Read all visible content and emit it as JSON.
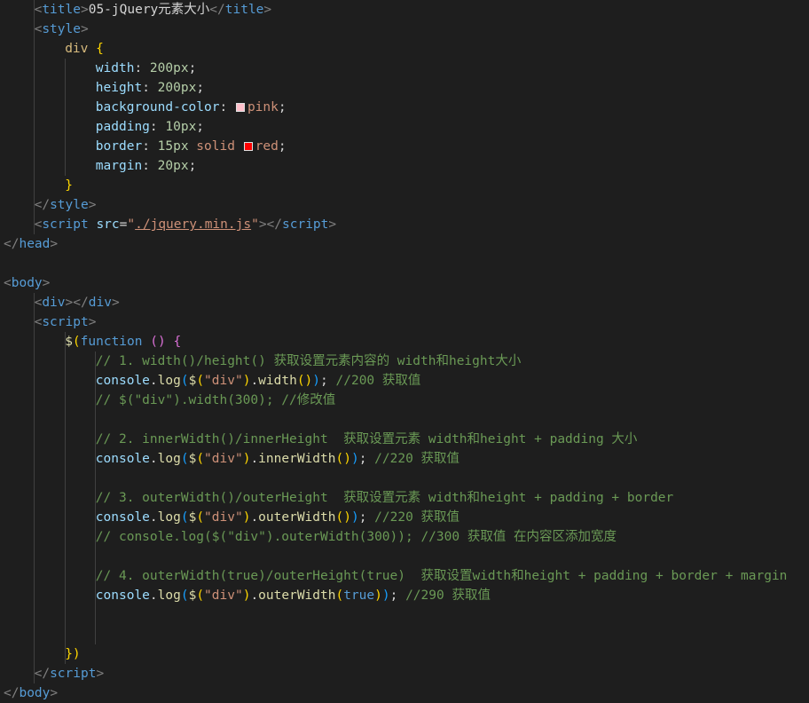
{
  "editor": {
    "lines": [
      [
        {
          "t": "<",
          "c": "punct"
        },
        {
          "t": "title",
          "c": "tag"
        },
        {
          "t": ">",
          "c": "punct"
        },
        {
          "t": "05-jQuery元素大小",
          "c": "text"
        },
        {
          "t": "</",
          "c": "punct"
        },
        {
          "t": "title",
          "c": "tag"
        },
        {
          "t": ">",
          "c": "punct"
        }
      ],
      [
        {
          "t": "<",
          "c": "punct"
        },
        {
          "t": "style",
          "c": "tag"
        },
        {
          "t": ">",
          "c": "punct"
        }
      ],
      [
        {
          "t": "div",
          "c": "sel"
        },
        {
          "t": " ",
          "c": "text"
        },
        {
          "t": "{",
          "c": "brace"
        }
      ],
      [
        {
          "t": "width",
          "c": "prop"
        },
        {
          "t": ": ",
          "c": "text"
        },
        {
          "t": "200px",
          "c": "num"
        },
        {
          "t": ";",
          "c": "text"
        }
      ],
      [
        {
          "t": "height",
          "c": "prop"
        },
        {
          "t": ": ",
          "c": "text"
        },
        {
          "t": "200px",
          "c": "num"
        },
        {
          "t": ";",
          "c": "text"
        }
      ],
      [
        {
          "t": "background-color",
          "c": "prop"
        },
        {
          "t": ": ",
          "c": "text"
        },
        {
          "swatch": "#ffc0cb"
        },
        {
          "t": "pink",
          "c": "val"
        },
        {
          "t": ";",
          "c": "text"
        }
      ],
      [
        {
          "t": "padding",
          "c": "prop"
        },
        {
          "t": ": ",
          "c": "text"
        },
        {
          "t": "10px",
          "c": "num"
        },
        {
          "t": ";",
          "c": "text"
        }
      ],
      [
        {
          "t": "border",
          "c": "prop"
        },
        {
          "t": ": ",
          "c": "text"
        },
        {
          "t": "15px",
          "c": "num"
        },
        {
          "t": " solid ",
          "c": "val"
        },
        {
          "swatch": "#ff0000"
        },
        {
          "t": "red",
          "c": "val"
        },
        {
          "t": ";",
          "c": "text"
        }
      ],
      [
        {
          "t": "margin",
          "c": "prop"
        },
        {
          "t": ": ",
          "c": "text"
        },
        {
          "t": "20px",
          "c": "num"
        },
        {
          "t": ";",
          "c": "text"
        }
      ],
      [
        {
          "t": "}",
          "c": "brace"
        }
      ],
      [
        {
          "t": "</",
          "c": "punct"
        },
        {
          "t": "style",
          "c": "tag"
        },
        {
          "t": ">",
          "c": "punct"
        }
      ],
      [
        {
          "t": "<",
          "c": "punct"
        },
        {
          "t": "script",
          "c": "tag"
        },
        {
          "t": " ",
          "c": "text"
        },
        {
          "t": "src",
          "c": "attr"
        },
        {
          "t": "=",
          "c": "text"
        },
        {
          "t": "\"",
          "c": "str"
        },
        {
          "t": "./jquery.min.js",
          "c": "link"
        },
        {
          "t": "\"",
          "c": "str"
        },
        {
          "t": "></",
          "c": "punct"
        },
        {
          "t": "script",
          "c": "tag"
        },
        {
          "t": ">",
          "c": "punct"
        }
      ],
      [
        {
          "t": "</",
          "c": "punct"
        },
        {
          "t": "head",
          "c": "tag"
        },
        {
          "t": ">",
          "c": "punct"
        }
      ],
      [],
      [
        {
          "t": "<",
          "c": "punct"
        },
        {
          "t": "body",
          "c": "tag"
        },
        {
          "t": ">",
          "c": "punct"
        }
      ],
      [
        {
          "t": "<",
          "c": "punct"
        },
        {
          "t": "div",
          "c": "tag"
        },
        {
          "t": "></",
          "c": "punct"
        },
        {
          "t": "div",
          "c": "tag"
        },
        {
          "t": ">",
          "c": "punct"
        }
      ],
      [
        {
          "t": "<",
          "c": "punct"
        },
        {
          "t": "script",
          "c": "tag"
        },
        {
          "t": ">",
          "c": "punct"
        }
      ],
      [
        {
          "t": "$",
          "c": "func"
        },
        {
          "t": "(",
          "c": "br1"
        },
        {
          "t": "function",
          "c": "kw"
        },
        {
          "t": " ",
          "c": "text"
        },
        {
          "t": "()",
          "c": "br2"
        },
        {
          "t": " ",
          "c": "text"
        },
        {
          "t": "{",
          "c": "br2"
        }
      ],
      [
        {
          "t": "// 1. width()/height() 获取设置元素内容的 width和height大小",
          "c": "comment"
        }
      ],
      [
        {
          "t": "console",
          "c": "var"
        },
        {
          "t": ".",
          "c": "text"
        },
        {
          "t": "log",
          "c": "func"
        },
        {
          "t": "(",
          "c": "br3"
        },
        {
          "t": "$",
          "c": "func"
        },
        {
          "t": "(",
          "c": "br1"
        },
        {
          "t": "\"div\"",
          "c": "str"
        },
        {
          "t": ")",
          "c": "br1"
        },
        {
          "t": ".",
          "c": "text"
        },
        {
          "t": "width",
          "c": "func"
        },
        {
          "t": "()",
          "c": "br1"
        },
        {
          "t": ")",
          "c": "br3"
        },
        {
          "t": "; ",
          "c": "text"
        },
        {
          "t": "//200 获取值",
          "c": "comment"
        }
      ],
      [
        {
          "t": "// $(\"div\").width(300); //修改值",
          "c": "comment"
        }
      ],
      [],
      [
        {
          "t": "// 2. innerWidth()/innerHeight  获取设置元素 width和height + padding 大小",
          "c": "comment"
        }
      ],
      [
        {
          "t": "console",
          "c": "var"
        },
        {
          "t": ".",
          "c": "text"
        },
        {
          "t": "log",
          "c": "func"
        },
        {
          "t": "(",
          "c": "br3"
        },
        {
          "t": "$",
          "c": "func"
        },
        {
          "t": "(",
          "c": "br1"
        },
        {
          "t": "\"div\"",
          "c": "str"
        },
        {
          "t": ")",
          "c": "br1"
        },
        {
          "t": ".",
          "c": "text"
        },
        {
          "t": "innerWidth",
          "c": "func"
        },
        {
          "t": "()",
          "c": "br1"
        },
        {
          "t": ")",
          "c": "br3"
        },
        {
          "t": "; ",
          "c": "text"
        },
        {
          "t": "//220 获取值",
          "c": "comment"
        }
      ],
      [],
      [
        {
          "t": "// 3. outerWidth()/outerHeight  获取设置元素 width和height + padding + border",
          "c": "comment"
        }
      ],
      [
        {
          "t": "console",
          "c": "var"
        },
        {
          "t": ".",
          "c": "text"
        },
        {
          "t": "log",
          "c": "func"
        },
        {
          "t": "(",
          "c": "br3"
        },
        {
          "t": "$",
          "c": "func"
        },
        {
          "t": "(",
          "c": "br1"
        },
        {
          "t": "\"div\"",
          "c": "str"
        },
        {
          "t": ")",
          "c": "br1"
        },
        {
          "t": ".",
          "c": "text"
        },
        {
          "t": "outerWidth",
          "c": "func"
        },
        {
          "t": "()",
          "c": "br1"
        },
        {
          "t": ")",
          "c": "br3"
        },
        {
          "t": "; ",
          "c": "text"
        },
        {
          "t": "//220 获取值",
          "c": "comment"
        }
      ],
      [
        {
          "t": "// console.log($(\"div\").outerWidth(300)); //300 获取值 在内容区添加宽度",
          "c": "comment"
        }
      ],
      [],
      [
        {
          "t": "// 4. outerWidth(true)/outerHeight(true)  获取设置width和height + padding + border + margin",
          "c": "comment"
        }
      ],
      [
        {
          "t": "console",
          "c": "var"
        },
        {
          "t": ".",
          "c": "text"
        },
        {
          "t": "log",
          "c": "func"
        },
        {
          "t": "(",
          "c": "br3"
        },
        {
          "t": "$",
          "c": "func"
        },
        {
          "t": "(",
          "c": "br1"
        },
        {
          "t": "\"div\"",
          "c": "str"
        },
        {
          "t": ")",
          "c": "br1"
        },
        {
          "t": ".",
          "c": "text"
        },
        {
          "t": "outerWidth",
          "c": "func"
        },
        {
          "t": "(",
          "c": "br1"
        },
        {
          "t": "true",
          "c": "kw"
        },
        {
          "t": ")",
          "c": "br1"
        },
        {
          "t": ")",
          "c": "br3"
        },
        {
          "t": "; ",
          "c": "text"
        },
        {
          "t": "//290 获取值",
          "c": "comment"
        }
      ],
      [],
      [],
      [
        {
          "t": "})",
          "c": "br1"
        }
      ],
      [
        {
          "t": "</",
          "c": "punct"
        },
        {
          "t": "script",
          "c": "tag"
        },
        {
          "t": ">",
          "c": "punct"
        }
      ],
      [
        {
          "t": "</",
          "c": "punct"
        },
        {
          "t": "body",
          "c": "tag"
        },
        {
          "t": ">",
          "c": "punct"
        }
      ]
    ]
  }
}
